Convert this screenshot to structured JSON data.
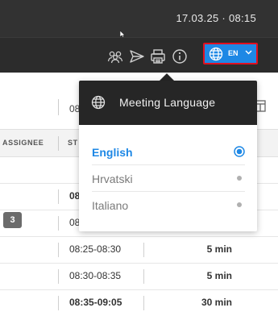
{
  "header": {
    "datetime": "17.03.25 · 08:15"
  },
  "toolbar": {
    "icons": [
      "participants-icon",
      "send-icon",
      "print-icon",
      "info-icon"
    ],
    "language_button": {
      "code": "EN",
      "color": "#1e88e5",
      "highlight": "#e01020"
    }
  },
  "table": {
    "header": {
      "assignee": "ASSIGNEE",
      "start": "ST"
    },
    "top_cell": "08",
    "rows": [
      {
        "time": "",
        "duration": ""
      },
      {
        "time": "08:",
        "duration": "",
        "bold": true
      },
      {
        "time": "08:",
        "duration": ""
      },
      {
        "time": "08:25-08:30",
        "duration": "5 min"
      },
      {
        "time": "08:30-08:35",
        "duration": "5 min"
      },
      {
        "time": "08:35-09:05",
        "duration": "30 min",
        "bold": true
      }
    ],
    "badge": "3"
  },
  "language_menu": {
    "title": "Meeting Language",
    "options": [
      {
        "label": "English",
        "selected": true
      },
      {
        "label": "Hrvatski",
        "selected": false
      },
      {
        "label": "Italiano",
        "selected": false
      }
    ],
    "accent": "#1e88e5"
  }
}
